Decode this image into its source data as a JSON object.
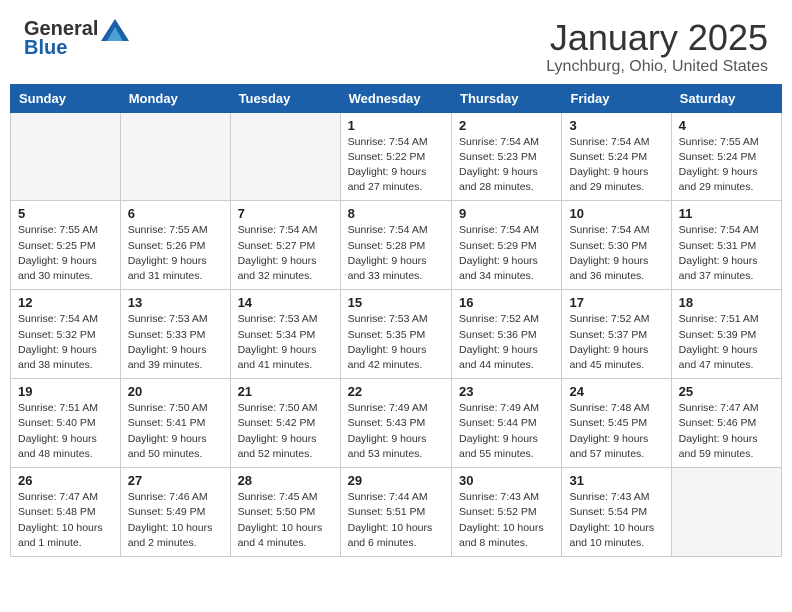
{
  "header": {
    "logo_general": "General",
    "logo_blue": "Blue",
    "month_title": "January 2025",
    "location": "Lynchburg, Ohio, United States"
  },
  "weekdays": [
    "Sunday",
    "Monday",
    "Tuesday",
    "Wednesday",
    "Thursday",
    "Friday",
    "Saturday"
  ],
  "weeks": [
    [
      {
        "day": "",
        "empty": true
      },
      {
        "day": "",
        "empty": true
      },
      {
        "day": "",
        "empty": true
      },
      {
        "day": "1",
        "sunrise": "Sunrise: 7:54 AM",
        "sunset": "Sunset: 5:22 PM",
        "daylight": "Daylight: 9 hours and 27 minutes."
      },
      {
        "day": "2",
        "sunrise": "Sunrise: 7:54 AM",
        "sunset": "Sunset: 5:23 PM",
        "daylight": "Daylight: 9 hours and 28 minutes."
      },
      {
        "day": "3",
        "sunrise": "Sunrise: 7:54 AM",
        "sunset": "Sunset: 5:24 PM",
        "daylight": "Daylight: 9 hours and 29 minutes."
      },
      {
        "day": "4",
        "sunrise": "Sunrise: 7:55 AM",
        "sunset": "Sunset: 5:24 PM",
        "daylight": "Daylight: 9 hours and 29 minutes."
      }
    ],
    [
      {
        "day": "5",
        "sunrise": "Sunrise: 7:55 AM",
        "sunset": "Sunset: 5:25 PM",
        "daylight": "Daylight: 9 hours and 30 minutes."
      },
      {
        "day": "6",
        "sunrise": "Sunrise: 7:55 AM",
        "sunset": "Sunset: 5:26 PM",
        "daylight": "Daylight: 9 hours and 31 minutes."
      },
      {
        "day": "7",
        "sunrise": "Sunrise: 7:54 AM",
        "sunset": "Sunset: 5:27 PM",
        "daylight": "Daylight: 9 hours and 32 minutes."
      },
      {
        "day": "8",
        "sunrise": "Sunrise: 7:54 AM",
        "sunset": "Sunset: 5:28 PM",
        "daylight": "Daylight: 9 hours and 33 minutes."
      },
      {
        "day": "9",
        "sunrise": "Sunrise: 7:54 AM",
        "sunset": "Sunset: 5:29 PM",
        "daylight": "Daylight: 9 hours and 34 minutes."
      },
      {
        "day": "10",
        "sunrise": "Sunrise: 7:54 AM",
        "sunset": "Sunset: 5:30 PM",
        "daylight": "Daylight: 9 hours and 36 minutes."
      },
      {
        "day": "11",
        "sunrise": "Sunrise: 7:54 AM",
        "sunset": "Sunset: 5:31 PM",
        "daylight": "Daylight: 9 hours and 37 minutes."
      }
    ],
    [
      {
        "day": "12",
        "sunrise": "Sunrise: 7:54 AM",
        "sunset": "Sunset: 5:32 PM",
        "daylight": "Daylight: 9 hours and 38 minutes."
      },
      {
        "day": "13",
        "sunrise": "Sunrise: 7:53 AM",
        "sunset": "Sunset: 5:33 PM",
        "daylight": "Daylight: 9 hours and 39 minutes."
      },
      {
        "day": "14",
        "sunrise": "Sunrise: 7:53 AM",
        "sunset": "Sunset: 5:34 PM",
        "daylight": "Daylight: 9 hours and 41 minutes."
      },
      {
        "day": "15",
        "sunrise": "Sunrise: 7:53 AM",
        "sunset": "Sunset: 5:35 PM",
        "daylight": "Daylight: 9 hours and 42 minutes."
      },
      {
        "day": "16",
        "sunrise": "Sunrise: 7:52 AM",
        "sunset": "Sunset: 5:36 PM",
        "daylight": "Daylight: 9 hours and 44 minutes."
      },
      {
        "day": "17",
        "sunrise": "Sunrise: 7:52 AM",
        "sunset": "Sunset: 5:37 PM",
        "daylight": "Daylight: 9 hours and 45 minutes."
      },
      {
        "day": "18",
        "sunrise": "Sunrise: 7:51 AM",
        "sunset": "Sunset: 5:39 PM",
        "daylight": "Daylight: 9 hours and 47 minutes."
      }
    ],
    [
      {
        "day": "19",
        "sunrise": "Sunrise: 7:51 AM",
        "sunset": "Sunset: 5:40 PM",
        "daylight": "Daylight: 9 hours and 48 minutes."
      },
      {
        "day": "20",
        "sunrise": "Sunrise: 7:50 AM",
        "sunset": "Sunset: 5:41 PM",
        "daylight": "Daylight: 9 hours and 50 minutes."
      },
      {
        "day": "21",
        "sunrise": "Sunrise: 7:50 AM",
        "sunset": "Sunset: 5:42 PM",
        "daylight": "Daylight: 9 hours and 52 minutes."
      },
      {
        "day": "22",
        "sunrise": "Sunrise: 7:49 AM",
        "sunset": "Sunset: 5:43 PM",
        "daylight": "Daylight: 9 hours and 53 minutes."
      },
      {
        "day": "23",
        "sunrise": "Sunrise: 7:49 AM",
        "sunset": "Sunset: 5:44 PM",
        "daylight": "Daylight: 9 hours and 55 minutes."
      },
      {
        "day": "24",
        "sunrise": "Sunrise: 7:48 AM",
        "sunset": "Sunset: 5:45 PM",
        "daylight": "Daylight: 9 hours and 57 minutes."
      },
      {
        "day": "25",
        "sunrise": "Sunrise: 7:47 AM",
        "sunset": "Sunset: 5:46 PM",
        "daylight": "Daylight: 9 hours and 59 minutes."
      }
    ],
    [
      {
        "day": "26",
        "sunrise": "Sunrise: 7:47 AM",
        "sunset": "Sunset: 5:48 PM",
        "daylight": "Daylight: 10 hours and 1 minute."
      },
      {
        "day": "27",
        "sunrise": "Sunrise: 7:46 AM",
        "sunset": "Sunset: 5:49 PM",
        "daylight": "Daylight: 10 hours and 2 minutes."
      },
      {
        "day": "28",
        "sunrise": "Sunrise: 7:45 AM",
        "sunset": "Sunset: 5:50 PM",
        "daylight": "Daylight: 10 hours and 4 minutes."
      },
      {
        "day": "29",
        "sunrise": "Sunrise: 7:44 AM",
        "sunset": "Sunset: 5:51 PM",
        "daylight": "Daylight: 10 hours and 6 minutes."
      },
      {
        "day": "30",
        "sunrise": "Sunrise: 7:43 AM",
        "sunset": "Sunset: 5:52 PM",
        "daylight": "Daylight: 10 hours and 8 minutes."
      },
      {
        "day": "31",
        "sunrise": "Sunrise: 7:43 AM",
        "sunset": "Sunset: 5:54 PM",
        "daylight": "Daylight: 10 hours and 10 minutes."
      },
      {
        "day": "",
        "empty": true
      }
    ]
  ]
}
